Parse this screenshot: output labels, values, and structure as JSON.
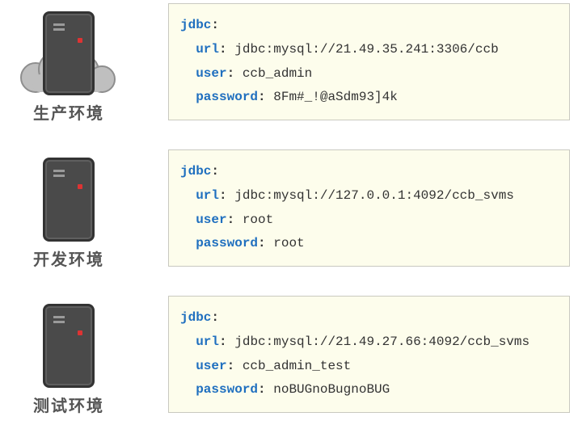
{
  "keys": {
    "jdbc": "jdbc",
    "url": "url",
    "user": "user",
    "password": "password",
    "colon": ":"
  },
  "envs": [
    {
      "id": "prod",
      "label": "生产环境",
      "has_cloud": true,
      "jdbc": {
        "url": "jdbc:mysql://21.49.35.241:3306/ccb",
        "user": "ccb_admin",
        "password": "8Fm#_!@aSdm93]4k"
      }
    },
    {
      "id": "dev",
      "label": "开发环境",
      "has_cloud": false,
      "jdbc": {
        "url": "jdbc:mysql://127.0.0.1:4092/ccb_svms",
        "user": "root",
        "password": "root"
      }
    },
    {
      "id": "test",
      "label": "测试环境",
      "has_cloud": false,
      "jdbc": {
        "url": "jdbc:mysql://21.49.27.66:4092/ccb_svms",
        "user": "ccb_admin_test",
        "password": "noBUGnoBugnoBUG"
      }
    }
  ]
}
